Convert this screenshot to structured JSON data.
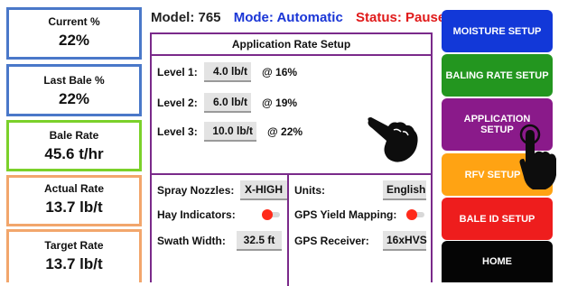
{
  "stats": [
    {
      "label": "Current %",
      "value": "22%"
    },
    {
      "label": "Last Bale %",
      "value": "22%"
    },
    {
      "label": "Bale Rate",
      "value": "45.6 t/hr"
    },
    {
      "label": "Actual Rate",
      "value": "13.7 lb/t"
    },
    {
      "label": "Target Rate",
      "value": "13.7 lb/t"
    }
  ],
  "header": {
    "model": "Model:  765",
    "mode": "Mode: Automatic",
    "status": "Status: Paused"
  },
  "panel": {
    "title": "Application Rate Setup",
    "levels": [
      {
        "label": "Level 1:",
        "rate": "4.0 lb/t",
        "moisture": "@ 16%"
      },
      {
        "label": "Level 2:",
        "rate": "6.0 lb/t",
        "moisture": "@ 19%"
      },
      {
        "label": "Level 3:",
        "rate": "10.0 lb/t",
        "moisture": "@ 22%"
      }
    ],
    "spray_nozzles_label": "Spray Nozzles:",
    "spray_nozzles_value": "X-HIGH",
    "hay_indicators_label": "Hay Indicators:",
    "swath_width_label": "Swath Width:",
    "swath_width_value": "32.5 ft",
    "units_label": "Units:",
    "units_value": "English",
    "gps_yield_label": "GPS Yield Mapping:",
    "gps_receiver_label": "GPS Receiver:",
    "gps_receiver_value": "16xHVS"
  },
  "nav": {
    "moisture_setup": "MOISTURE SETUP",
    "baling_rate_setup": "BALING RATE SETUP",
    "application_setup": "APPLICATION SETUP",
    "rfv_setup": "RFV SETUP",
    "bale_id_setup": "BALE ID SETUP",
    "home": "HOME"
  },
  "colors": {
    "moisture": "#1238d8",
    "baling_rate": "#23961f",
    "application": "#8a1a8a",
    "rfv": "#ffa313",
    "bale_id": "#ee1d1d",
    "home": "#050505",
    "panel_border": "#7a2a8a",
    "toggle_on": "#ff2a1a"
  }
}
